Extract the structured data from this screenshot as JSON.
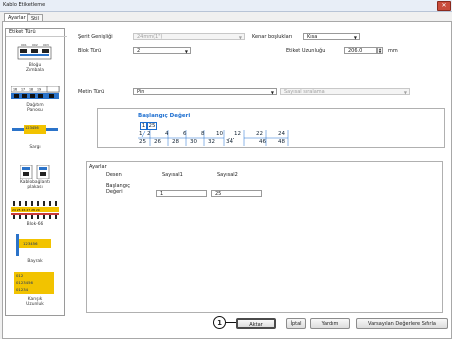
{
  "window": {
    "title": "Kablo Etiketleme"
  },
  "tabs": [
    {
      "label": "Ayarlar"
    },
    {
      "label": "Stil"
    }
  ],
  "sidebar": {
    "header": "Etiket Türü",
    "items": [
      {
        "label": "Bloğu\nZımbala",
        "icon": "punchdown-block-icon"
      },
      {
        "label": "Dağıtım\nPanosu",
        "icon": "patch-panel-icon"
      },
      {
        "label": "Sargı",
        "icon": "cable-wrap-icon"
      },
      {
        "label": "Kablobağlantı\nplakası",
        "icon": "faceplate-icon"
      },
      {
        "label": "Blok-66",
        "icon": "block66-icon"
      },
      {
        "label": "Bayrak",
        "icon": "flag-label-icon"
      },
      {
        "label": "Karışık\nUzunluk",
        "icon": "mixed-length-icon"
      }
    ],
    "wrap_sample": "123456",
    "flag_sample": "123456",
    "mixed_samples": [
      "012",
      "0123456",
      "01234"
    ],
    "pin_samples": [
      "16 17 18 19",
      "24 25 26 27 28 29"
    ]
  },
  "form": {
    "tape_width": {
      "label": "Şerit Genişliği",
      "value": "24mm(1\")"
    },
    "margin": {
      "label": "Kenar boşlukları",
      "value": "Kısa"
    },
    "block_type": {
      "label": "Blok Türü",
      "value": "2"
    },
    "label_length": {
      "label": "Etiket Uzunluğu",
      "value": "206.0",
      "unit": "mm"
    },
    "text_type": {
      "label": "Metin Türü",
      "value": "Pin"
    },
    "sequence": {
      "value": "Sayısal sıralama"
    }
  },
  "preview": {
    "title": "Başlangıç Değeri",
    "boxed": [
      "1",
      "25"
    ],
    "top_row": [
      "1",
      "2",
      "4",
      "6",
      "8",
      "10",
      "12",
      "22",
      "24"
    ],
    "bottom_row": [
      "25",
      "26",
      "28",
      "30",
      "32",
      "34",
      "36",
      "46",
      "48"
    ],
    "ellipsis": "..."
  },
  "settings": {
    "title": "Ayarlar",
    "pattern_label": "Desen",
    "col1": "Sayısal1",
    "col2": "Sayısal2",
    "start_label": "Başlangıç\nDeğeri",
    "start1": "1",
    "start2": "25"
  },
  "buttons": {
    "apply": "Aktar",
    "cancel": "İptal",
    "help": "Yardım",
    "defaults": "Varsayılan Değerlere Sıfırla"
  },
  "callout": "1",
  "colors": {
    "accent": "#1e6fd0",
    "label_blue": "#2b73c9",
    "label_yellow": "#f2c300"
  }
}
